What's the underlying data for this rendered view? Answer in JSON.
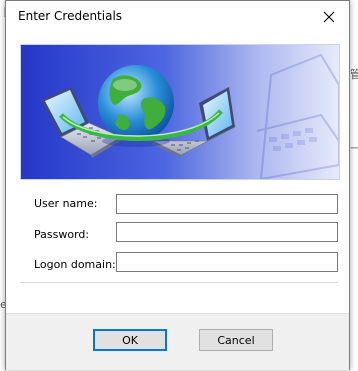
{
  "background": {
    "fragment_top_left": "ㅣ",
    "fragment_right_1": "管",
    "fragment_right_2": "ㅡ",
    "fragment_left_mid": "er"
  },
  "dialog": {
    "title": "Enter Credentials",
    "banner_icon": "network-globe-laptops-illustration"
  },
  "form": {
    "username_label": "User name:",
    "username_value": "",
    "password_label": "Password:",
    "password_value": "",
    "domain_label": "Logon domain:",
    "domain_value": ""
  },
  "buttons": {
    "ok_label": "OK",
    "cancel_label": "Cancel"
  },
  "colors": {
    "accent": "#0078d7",
    "banner_blue": "#3a55d6",
    "globe_green": "#3fae3b"
  }
}
